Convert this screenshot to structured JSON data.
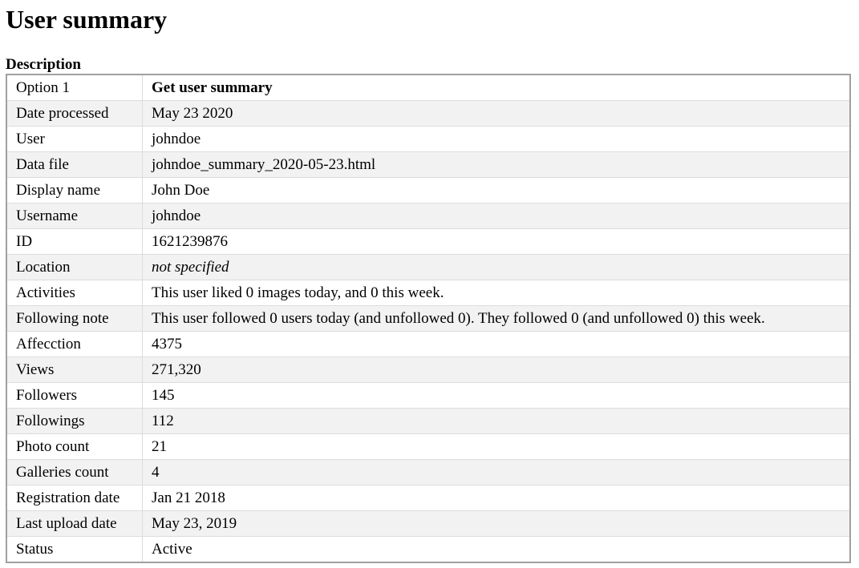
{
  "page": {
    "title": "User summary",
    "caption": "Description"
  },
  "rows": [
    {
      "key": "Option 1",
      "value": "Get user summary"
    },
    {
      "key": "Date processed",
      "value": "May 23 2020"
    },
    {
      "key": "User",
      "value": "johndoe"
    },
    {
      "key": "Data file",
      "value": "johndoe_summary_2020-05-23.html"
    },
    {
      "key": "Display name",
      "value": "John Doe"
    },
    {
      "key": "Username",
      "value": "johndoe"
    },
    {
      "key": "ID",
      "value": "1621239876"
    },
    {
      "key": "Location",
      "value": "not specified"
    },
    {
      "key": "Activities",
      "value": "This user liked 0 images today, and 0 this week."
    },
    {
      "key": "Following note",
      "value": "This user followed 0 users today (and unfollowed 0). They followed 0 (and unfollowed 0) this week."
    },
    {
      "key": "Affecction",
      "value": "4375"
    },
    {
      "key": "Views",
      "value": "271,320"
    },
    {
      "key": "Followers",
      "value": "145"
    },
    {
      "key": "Followings",
      "value": "112"
    },
    {
      "key": "Photo count",
      "value": "21"
    },
    {
      "key": "Galleries count",
      "value": "4"
    },
    {
      "key": "Registration date",
      "value": "Jan 21 2018"
    },
    {
      "key": "Last upload date",
      "value": "May 23, 2019"
    },
    {
      "key": "Status",
      "value": "Active"
    }
  ]
}
